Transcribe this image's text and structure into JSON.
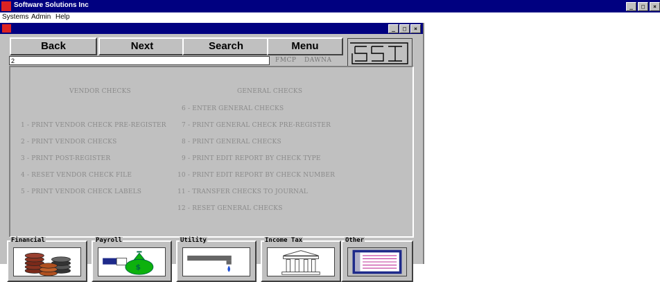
{
  "app": {
    "title": "Software Solutions Inc"
  },
  "outer_controls": {
    "minimize": "_",
    "maximize": "□",
    "close": "×"
  },
  "menubar": [
    "Systems",
    "Admin",
    "Help"
  ],
  "child_controls": {
    "minimize": "_",
    "maximize": "□",
    "close": "×"
  },
  "nav": {
    "back": "Back",
    "next": "Next",
    "search": "Search",
    "menu": "Menu"
  },
  "command": {
    "value": "2"
  },
  "status": {
    "left": "FMCP",
    "right": "DAWNA"
  },
  "logo": {
    "text": "SSI"
  },
  "menu": {
    "left_heading": "VENDOR CHECKS",
    "right_heading": "GENERAL CHECKS",
    "left_items": [
      "1 - PRINT VENDOR CHECK PRE-REGISTER",
      "2 - PRINT VENDOR CHECKS",
      "3 - PRINT POST-REGISTER",
      "4 - RESET VENDOR CHECK FILE",
      "5 - PRINT VENDOR CHECK LABELS"
    ],
    "right_items": [
      "6 - ENTER GENERAL CHECKS",
      "7 - PRINT GENERAL CHECK PRE-REGISTER",
      "8 - PRINT GENERAL CHECKS",
      "9 - PRINT EDIT REPORT BY CHECK TYPE",
      "10 - PRINT EDIT REPORT BY CHECK NUMBER",
      "11 - TRANSFER CHECKS TO JOURNAL",
      "12 - RESET GENERAL CHECKS"
    ]
  },
  "modules": [
    {
      "label": "Financial",
      "icon": "coins-icon"
    },
    {
      "label": "Payroll",
      "icon": "money-bag-icon"
    },
    {
      "label": "Utility",
      "icon": "faucet-icon"
    },
    {
      "label": "Income Tax",
      "icon": "building-icon"
    },
    {
      "label": "Other",
      "icon": "window-icon"
    }
  ]
}
